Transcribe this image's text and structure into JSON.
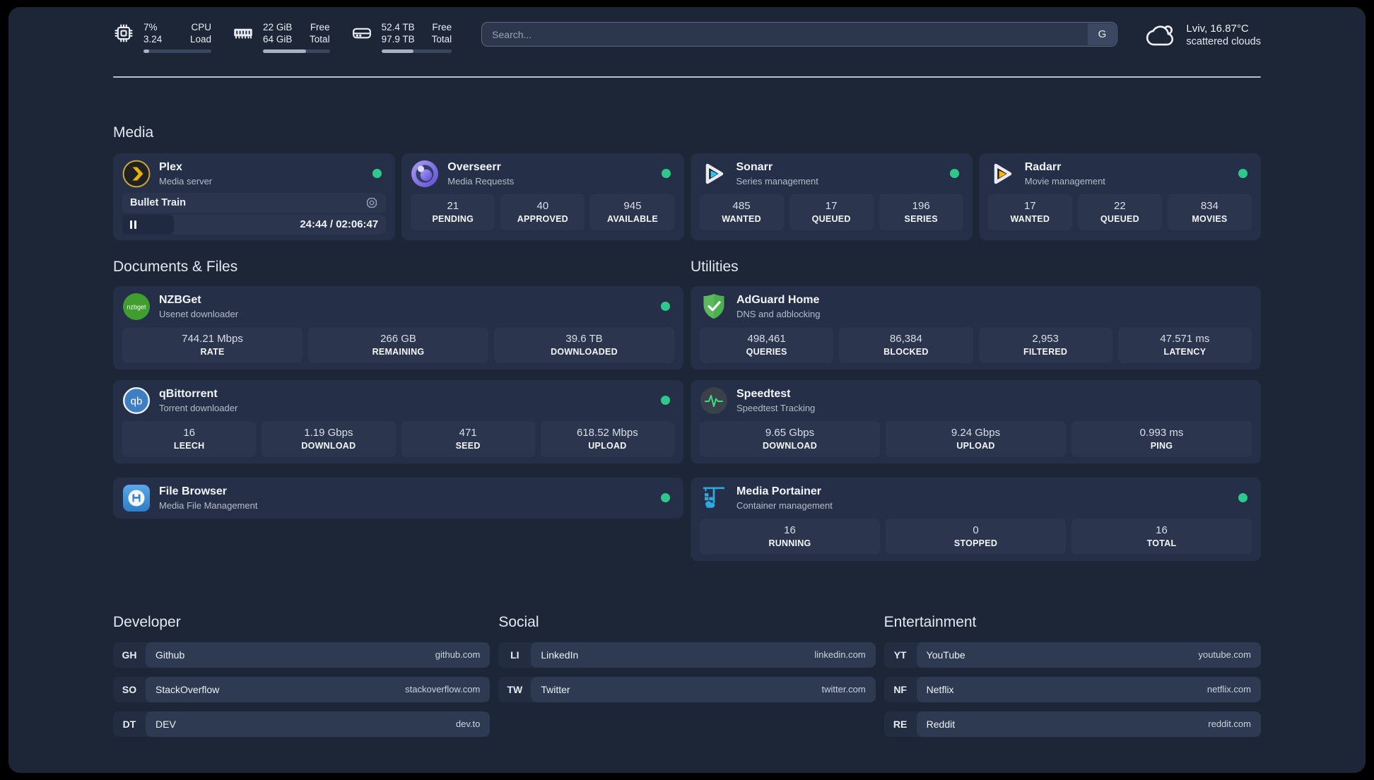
{
  "topbar": {
    "metrics": [
      {
        "id": "cpu",
        "value_top": "7%",
        "value_bottom": "3.24",
        "label_top": "CPU",
        "label_bottom": "Load",
        "progress_pct": 8
      },
      {
        "id": "memory",
        "value_top": "22 GiB",
        "value_bottom": "64 GiB",
        "label_top": "Free",
        "label_bottom": "Total",
        "progress_pct": 65
      },
      {
        "id": "disk",
        "value_top": "52.4 TB",
        "value_bottom": "97.9 TB",
        "label_top": "Free",
        "label_bottom": "Total",
        "progress_pct": 46
      }
    ],
    "search": {
      "placeholder": "Search...",
      "engine_label": "G"
    },
    "weather": {
      "line1": "Lviv, 16.87°C",
      "line2": "scattered clouds"
    }
  },
  "sections": {
    "media": {
      "title": "Media",
      "apps": [
        {
          "name": "Plex",
          "subtitle": "Media server",
          "online": true,
          "now_playing": {
            "title": "Bullet Train",
            "time_display": "24:44 / 02:06:47",
            "progress_pct": 19.5
          }
        },
        {
          "name": "Overseerr",
          "subtitle": "Media Requests",
          "online": true,
          "stats": [
            {
              "value": "21",
              "label": "PENDING"
            },
            {
              "value": "40",
              "label": "APPROVED"
            },
            {
              "value": "945",
              "label": "AVAILABLE"
            }
          ]
        },
        {
          "name": "Sonarr",
          "subtitle": "Series management",
          "online": true,
          "stats": [
            {
              "value": "485",
              "label": "WANTED"
            },
            {
              "value": "17",
              "label": "QUEUED"
            },
            {
              "value": "196",
              "label": "SERIES"
            }
          ]
        },
        {
          "name": "Radarr",
          "subtitle": "Movie management",
          "online": true,
          "stats": [
            {
              "value": "17",
              "label": "WANTED"
            },
            {
              "value": "22",
              "label": "QUEUED"
            },
            {
              "value": "834",
              "label": "MOVIES"
            }
          ]
        }
      ]
    },
    "documents": {
      "title": "Documents & Files",
      "apps": [
        {
          "name": "NZBGet",
          "subtitle": "Usenet downloader",
          "online": true,
          "stats": [
            {
              "value": "744.21 Mbps",
              "label": "RATE"
            },
            {
              "value": "266 GB",
              "label": "REMAINING"
            },
            {
              "value": "39.6 TB",
              "label": "DOWNLOADED"
            }
          ]
        },
        {
          "name": "qBittorrent",
          "subtitle": "Torrent downloader",
          "online": true,
          "stats": [
            {
              "value": "16",
              "label": "LEECH"
            },
            {
              "value": "1.19 Gbps",
              "label": "DOWNLOAD"
            },
            {
              "value": "471",
              "label": "SEED"
            },
            {
              "value": "618.52 Mbps",
              "label": "UPLOAD"
            }
          ]
        },
        {
          "name": "File Browser",
          "subtitle": "Media File Management",
          "online": true,
          "stats": []
        }
      ]
    },
    "utilities": {
      "title": "Utilities",
      "apps": [
        {
          "name": "AdGuard Home",
          "subtitle": "DNS and adblocking",
          "online": false,
          "stats": [
            {
              "value": "498,461",
              "label": "QUERIES"
            },
            {
              "value": "86,384",
              "label": "BLOCKED"
            },
            {
              "value": "2,953",
              "label": "FILTERED"
            },
            {
              "value": "47.571 ms",
              "label": "LATENCY"
            }
          ]
        },
        {
          "name": "Speedtest",
          "subtitle": "Speedtest Tracking",
          "online": false,
          "stats": [
            {
              "value": "9.65 Gbps",
              "label": "DOWNLOAD"
            },
            {
              "value": "9.24 Gbps",
              "label": "UPLOAD"
            },
            {
              "value": "0.993 ms",
              "label": "PING"
            }
          ]
        },
        {
          "name": "Media Portainer",
          "subtitle": "Container management",
          "online": true,
          "stats": [
            {
              "value": "16",
              "label": "RUNNING"
            },
            {
              "value": "0",
              "label": "STOPPED"
            },
            {
              "value": "16",
              "label": "TOTAL"
            }
          ]
        }
      ]
    },
    "developer": {
      "title": "Developer",
      "links": [
        {
          "abbr": "GH",
          "name": "Github",
          "url": "github.com"
        },
        {
          "abbr": "SO",
          "name": "StackOverflow",
          "url": "stackoverflow.com"
        },
        {
          "abbr": "DT",
          "name": "DEV",
          "url": "dev.to"
        }
      ]
    },
    "social": {
      "title": "Social",
      "links": [
        {
          "abbr": "LI",
          "name": "LinkedIn",
          "url": "linkedin.com"
        },
        {
          "abbr": "TW",
          "name": "Twitter",
          "url": "twitter.com"
        }
      ]
    },
    "entertainment": {
      "title": "Entertainment",
      "links": [
        {
          "abbr": "YT",
          "name": "YouTube",
          "url": "youtube.com"
        },
        {
          "abbr": "NF",
          "name": "Netflix",
          "url": "netflix.com"
        },
        {
          "abbr": "RE",
          "name": "Reddit",
          "url": "reddit.com"
        }
      ]
    }
  },
  "icons": {
    "nzbget_text": "nzbget",
    "qbittorrent_text": "qb"
  },
  "colors": {
    "status_online": "#2dc98c",
    "plex_yellow": "#ebaf00",
    "sonarr_blue": "#33c0f3",
    "radarr_yellow": "#ffb400",
    "adguard_green": "#5cb85f",
    "speedtest_green": "#3ddc84",
    "portainer_blue": "#2fa8e0",
    "overseerr_purple": "#6554c8",
    "nzbget_green": "#3f9e2f",
    "qbittorrent_blue": "#3f7fc1",
    "filebrowser_blue": "#2e7dc6"
  }
}
